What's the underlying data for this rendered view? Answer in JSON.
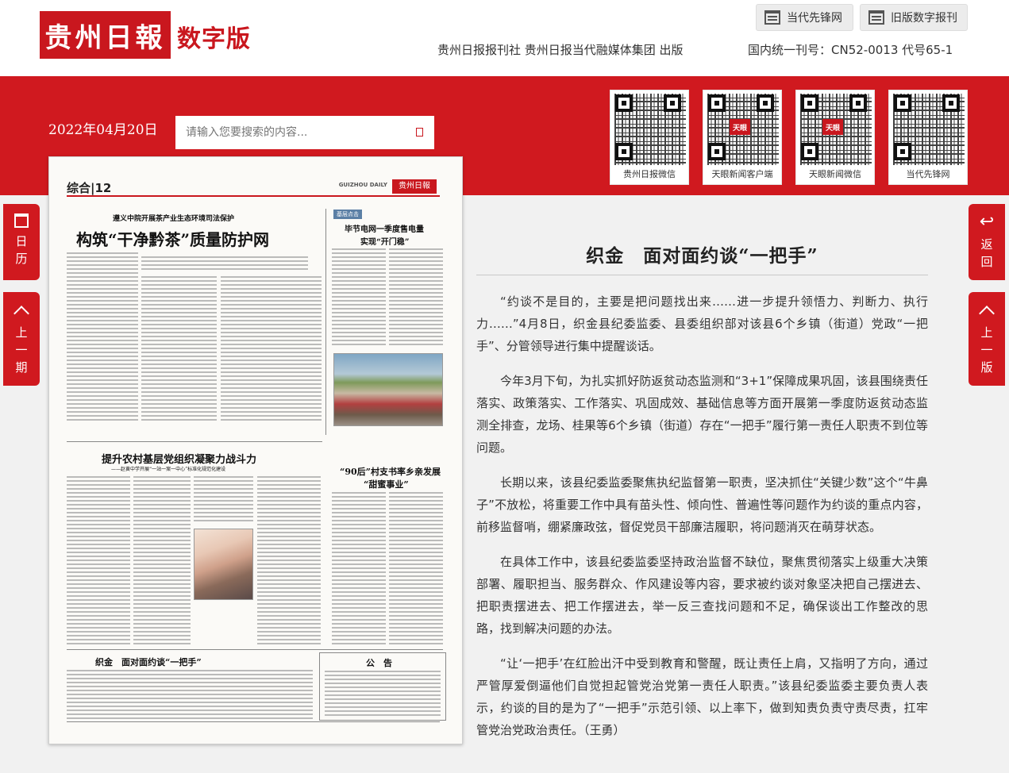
{
  "header": {
    "logo_text": "贵州日報",
    "logo_subtitle": "数字版",
    "buttons": [
      {
        "label": "当代先锋网",
        "icon": "calendar-grid-icon"
      },
      {
        "label": "旧版数字报刊",
        "icon": "calendar-grid-icon"
      }
    ],
    "publisher": "贵州日报报刊社  贵州日报当代融媒体集团  出版",
    "issn": "国内统一刊号：CN52-0013  代号65-1"
  },
  "toolbar": {
    "date": "2022年04月20日",
    "search_placeholder": "请输入您要搜索的内容..."
  },
  "qr_codes": [
    {
      "label": "贵州日报微信",
      "badge": ""
    },
    {
      "label": "天眼新闻客户端",
      "badge": "天眼"
    },
    {
      "label": "天眼新闻微信",
      "badge": "天眼"
    },
    {
      "label": "当代先锋网",
      "badge": ""
    }
  ],
  "side_nav": {
    "left": [
      {
        "label": "日历",
        "icon": "calendar-icon"
      },
      {
        "label": "上一期",
        "icon": "chevron-up-icon"
      }
    ],
    "right": [
      {
        "label": "返回",
        "icon": "return-arrow-icon"
      },
      {
        "label": "上一版",
        "icon": "chevron-up-icon"
      }
    ]
  },
  "newspaper_page": {
    "section": "综合|12",
    "masthead": "贵州日報",
    "masthead_en": "GUIZHOU DAILY",
    "headlines": {
      "main_kicker": "遵义中院开展茶产业生态环境司法保护",
      "main": "构筑“干净黔茶”质量防护网",
      "right_tag": "基层点击",
      "right": "毕节电网一季度售电量",
      "right2": "实现“开门稳”",
      "second": "提升农村基层党组织凝聚力战斗力",
      "second_sub": "——赵黄中学开展“一站一案一中心”标准化规范化建设",
      "third": "“90后”村支书率乡亲发展",
      "third2": "“甜蜜事业”",
      "bottom": "织金　面对面约谈“一把手”",
      "notice": "公　告"
    }
  },
  "article": {
    "title": "织金　面对面约谈“一把手”",
    "paragraphs": [
      "“约谈不是目的，主要是把问题找出来……进一步提升领悟力、判断力、执行力……”4月8日，织金县纪委监委、县委组织部对该县6个乡镇（街道）党政“一把手”、分管领导进行集中提醒谈话。",
      "今年3月下旬，为扎实抓好防返贫动态监测和“3+1”保障成果巩固，该县围绕责任落实、政策落实、工作落实、巩固成效、基础信息等方面开展第一季度防返贫动态监测全排查，龙场、桂果等6个乡镇（街道）存在“一把手”履行第一责任人职责不到位等问题。",
      "长期以来，该县纪委监委聚焦执纪监督第一职责，坚决抓住“关键少数”这个“牛鼻子”不放松，将重要工作中具有苗头性、倾向性、普遍性等问题作为约谈的重点内容，前移监督哨，绷紧廉政弦，督促党员干部廉洁履职，将问题消灭在萌芽状态。",
      "在具体工作中，该县纪委监委坚持政治监督不缺位，聚焦贯彻落实上级重大决策部署、履职担当、服务群众、作风建设等内容，要求被约谈对象坚决把自己摆进去、把职责摆进去、把工作摆进去，举一反三查找问题和不足，确保谈出工作整改的思路，找到解决问题的办法。",
      "“让‘一把手’在红脸出汗中受到教育和警醒，既让责任上肩，又指明了方向，通过严管厚爱倒逼他们自觉担起管党治党第一责任人职责。”该县纪委监委主要负责人表示，约谈的目的是为了“一把手”示范引领、以上率下，做到知责负责守责尽责，扛牢管党治党政治责任。（王勇）"
    ]
  }
}
